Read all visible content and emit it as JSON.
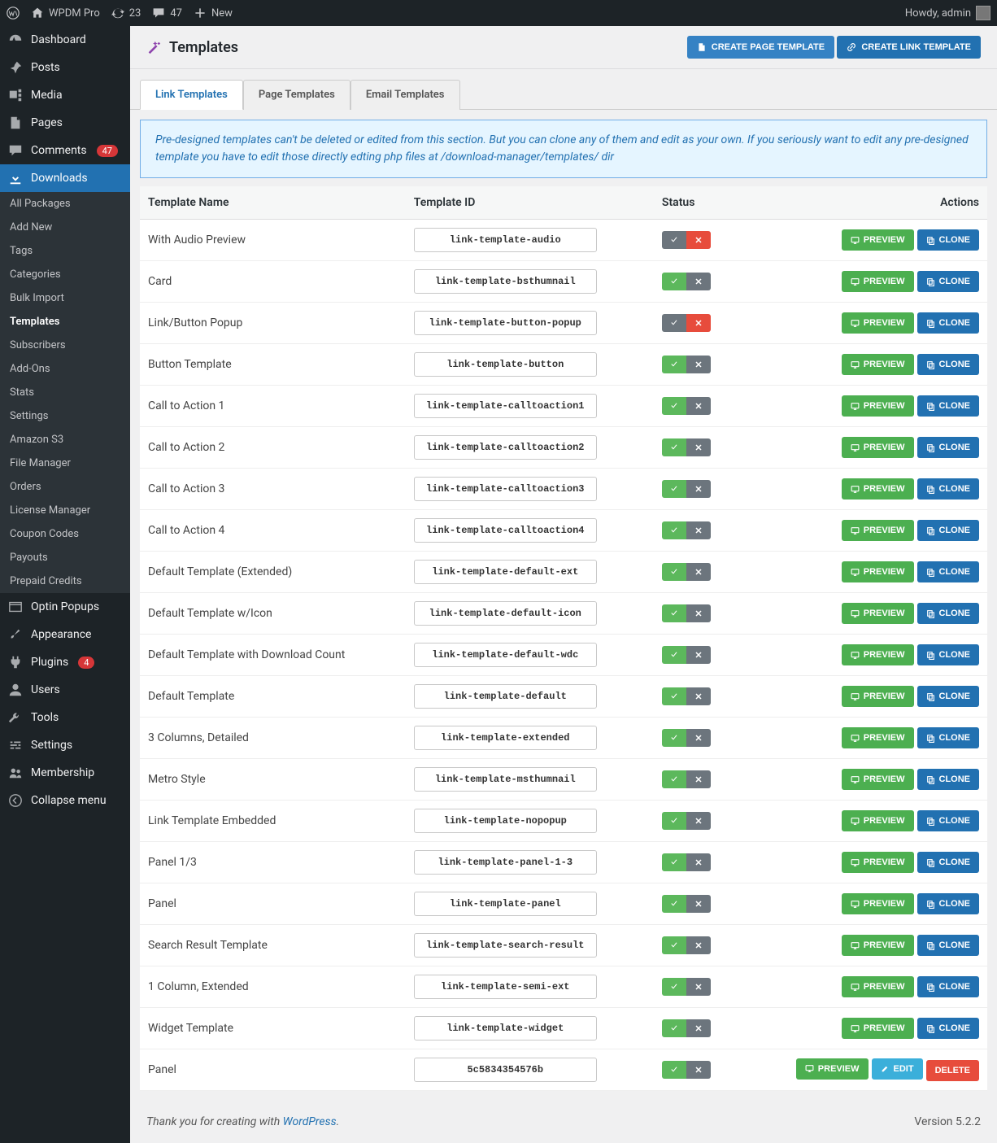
{
  "adminbar": {
    "site_name": "WPDM Pro",
    "updates": "23",
    "comments": "47",
    "new": "New",
    "howdy": "Howdy, admin"
  },
  "menu": [
    {
      "label": "Dashboard",
      "icon": "gauge"
    },
    {
      "label": "Posts",
      "icon": "pin"
    },
    {
      "label": "Media",
      "icon": "media"
    },
    {
      "label": "Pages",
      "icon": "page"
    },
    {
      "label": "Comments",
      "icon": "comment",
      "badge": "47"
    },
    {
      "label": "Downloads",
      "icon": "download",
      "active": true
    },
    {
      "label": "Optin Popups",
      "icon": "popup"
    },
    {
      "label": "Appearance",
      "icon": "brush"
    },
    {
      "label": "Plugins",
      "icon": "plug",
      "badge": "4"
    },
    {
      "label": "Users",
      "icon": "user"
    },
    {
      "label": "Tools",
      "icon": "wrench"
    },
    {
      "label": "Settings",
      "icon": "sliders"
    },
    {
      "label": "Membership",
      "icon": "group"
    },
    {
      "label": "Collapse menu",
      "icon": "collapse"
    }
  ],
  "submenu_index": 5,
  "submenu": [
    {
      "label": "All Packages"
    },
    {
      "label": "Add New"
    },
    {
      "label": "Tags"
    },
    {
      "label": "Categories"
    },
    {
      "label": "Bulk Import"
    },
    {
      "label": "Templates",
      "current": true
    },
    {
      "label": "Subscribers"
    },
    {
      "label": "Add-Ons"
    },
    {
      "label": "Stats"
    },
    {
      "label": "Settings"
    },
    {
      "label": "Amazon S3"
    },
    {
      "label": "File Manager"
    },
    {
      "label": "Orders"
    },
    {
      "label": "License Manager"
    },
    {
      "label": "Coupon Codes"
    },
    {
      "label": "Payouts"
    },
    {
      "label": "Prepaid Credits"
    }
  ],
  "header": {
    "title": "Templates",
    "btn_page": "CREATE PAGE TEMPLATE",
    "btn_link": "CREATE LINK TEMPLATE"
  },
  "tabs": [
    {
      "label": "Link Templates",
      "active": true
    },
    {
      "label": "Page Templates"
    },
    {
      "label": "Email Templates"
    }
  ],
  "notice": "Pre-designed templates can't be deleted or edited from this section. But you can clone any of them and edit as your own. If you seriously want to edit any pre-designed template you have to edit those directly edting php files at /download-manager/templates/ dir",
  "columns": {
    "name": "Template Name",
    "id": "Template ID",
    "status": "Status",
    "actions": "Actions"
  },
  "action_labels": {
    "preview": "PREVIEW",
    "clone": "CLONE",
    "edit": "EDIT",
    "delete": "DELETE"
  },
  "rows": [
    {
      "name": "With Audio Preview",
      "tid": "link-template-audio",
      "status": "off"
    },
    {
      "name": "Card",
      "tid": "link-template-bsthumnail",
      "status": "on"
    },
    {
      "name": "Link/Button Popup",
      "tid": "link-template-button-popup",
      "status": "off"
    },
    {
      "name": "Button Template",
      "tid": "link-template-button",
      "status": "on"
    },
    {
      "name": "Call to Action 1",
      "tid": "link-template-calltoaction1",
      "status": "on"
    },
    {
      "name": "Call to Action 2",
      "tid": "link-template-calltoaction2",
      "status": "on"
    },
    {
      "name": "Call to Action 3",
      "tid": "link-template-calltoaction3",
      "status": "on"
    },
    {
      "name": "Call to Action 4",
      "tid": "link-template-calltoaction4",
      "status": "on"
    },
    {
      "name": "Default Template (Extended)",
      "tid": "link-template-default-ext",
      "status": "on"
    },
    {
      "name": "Default Template w/Icon",
      "tid": "link-template-default-icon",
      "status": "on"
    },
    {
      "name": "Default Template with Download Count",
      "tid": "link-template-default-wdc",
      "status": "on"
    },
    {
      "name": "Default Template",
      "tid": "link-template-default",
      "status": "on"
    },
    {
      "name": "3 Columns, Detailed",
      "tid": "link-template-extended",
      "status": "on"
    },
    {
      "name": "Metro Style",
      "tid": "link-template-msthumnail",
      "status": "on"
    },
    {
      "name": "Link Template Embedded",
      "tid": "link-template-nopopup",
      "status": "on"
    },
    {
      "name": "Panel 1/3",
      "tid": "link-template-panel-1-3",
      "status": "on"
    },
    {
      "name": "Panel",
      "tid": "link-template-panel",
      "status": "on"
    },
    {
      "name": "Search Result Template",
      "tid": "link-template-search-result",
      "status": "on"
    },
    {
      "name": "1 Column, Extended",
      "tid": "link-template-semi-ext",
      "status": "on"
    },
    {
      "name": "Widget Template",
      "tid": "link-template-widget",
      "status": "on"
    },
    {
      "name": "Panel",
      "tid": "5c5834354576b",
      "status": "on",
      "custom": true
    }
  ],
  "footer": {
    "thank_you_prefix": "Thank you for creating with ",
    "wordpress": "WordPress",
    "suffix": ".",
    "version": "Version 5.2.2"
  }
}
